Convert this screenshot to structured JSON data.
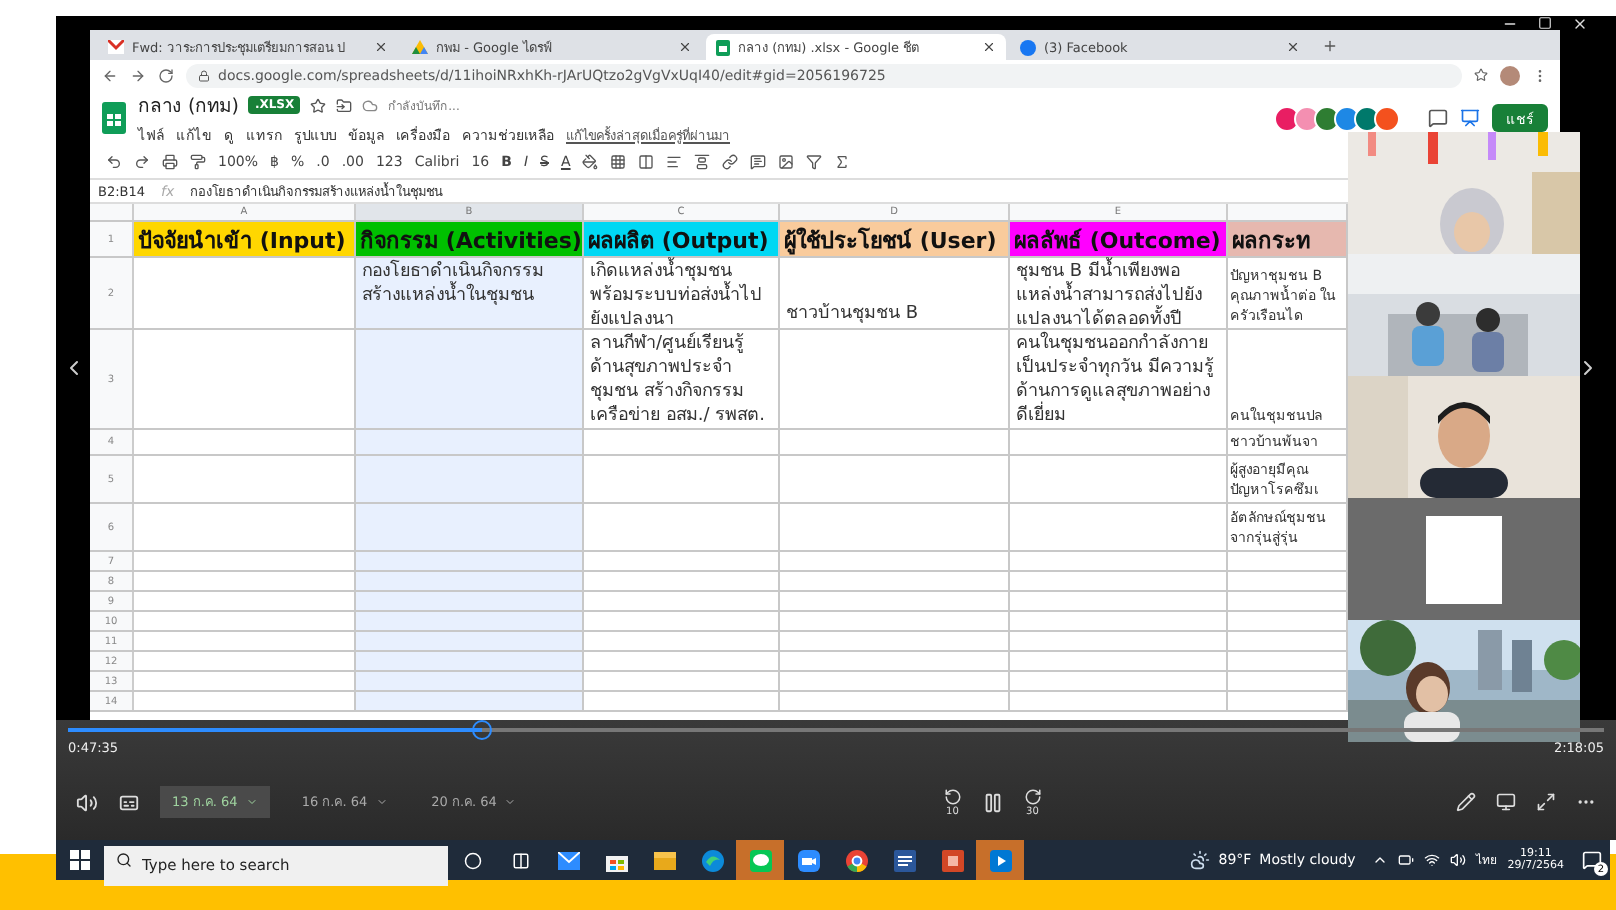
{
  "browser": {
    "tabs": [
      {
        "kind": "gmail",
        "title": "Fwd: วาระการประชุมเตรียมการสอน ป",
        "selected": false
      },
      {
        "kind": "drive",
        "title": "กพม - Google ไดรฟ์",
        "selected": false
      },
      {
        "kind": "sheets",
        "title": "กลาง (กทม) .xlsx - Google ชีต",
        "selected": true
      },
      {
        "kind": "facebook",
        "title": "(3) Facebook",
        "selected": false
      }
    ],
    "url": "docs.google.com/spreadsheets/d/11ihoiNRxhKh-rJArUQtzo2gVgVxUqI40/edit#gid=2056196725"
  },
  "sheet": {
    "title": "กลาง (กทม)",
    "badge": ".XLSX",
    "save_status": "กำลังบันทึก...",
    "menu": [
      "ไฟล์",
      "แก้ไข",
      "ดู",
      "แทรก",
      "รูปแบบ",
      "ข้อมูล",
      "เครื่องมือ",
      "ความช่วยเหลือ"
    ],
    "last_edit": "แก้ไขครั้งล่าสุดเมื่อครู่ที่ผ่านมา",
    "collaborators": [
      {
        "color": "#e91e63"
      },
      {
        "color": "#f48fb1"
      },
      {
        "color": "#2e7d32"
      },
      {
        "color": "#1e88e5"
      },
      {
        "color": "#00796b"
      },
      {
        "color": "#f4511e"
      }
    ],
    "share_label": "แชร์",
    "toolbar": [
      "100%",
      "฿",
      "%",
      ".0",
      ".00",
      "123",
      "Calibri",
      "16"
    ],
    "format": [
      "B",
      "I",
      "S",
      "A"
    ],
    "name_box": "B2:B14",
    "fx": "fx",
    "formula": "กองโยธาดำเนินกิจกรรมสร้างแหล่งน้ำในชุมชน",
    "columns": [
      {
        "letter": "A",
        "heading": "ปัจจัยนำเข้า (Input)",
        "color": "#ffd700",
        "selected": false
      },
      {
        "letter": "B",
        "heading": "กิจกรรม (Activities)",
        "color": "#00c000",
        "selected": true
      },
      {
        "letter": "C",
        "heading": "ผลผลิต (Output)",
        "color": "#00d8f4",
        "selected": false
      },
      {
        "letter": "D",
        "heading": "ผู้ใช้ประโยชน์ (User)",
        "color": "#f9cb9c",
        "selected": false
      },
      {
        "letter": "E",
        "heading": "ผลลัพธ์ (Outcome)",
        "color": "#ff00ff",
        "selected": false
      },
      {
        "heading": "ผลกระท",
        "color": "#e6b8af",
        "selected": false
      }
    ],
    "rows": [
      {
        "number": "1"
      },
      {
        "number": "2",
        "cells": {
          "B": "กองโยธาดำเนินกิจกรรม สร้างแหล่งน้ำในชุมชน",
          "C": "เกิดแหล่งน้ำชุมชน พร้อมระบบท่อส่งน้ำไปยังแปลงนา",
          "D": "ชาวบ้านชุมชน B",
          "E": "ชุมชน B มีน้ำเพียงพอ แหล่งน้ำสามารถส่งไปยังแปลงนาได้ตลอดทั้งปี",
          "F": "ปัญหาชุมชน B คุณภาพน้ำต่อ ในครัวเรือนได"
        }
      },
      {
        "number": "3",
        "cells": {
          "C": "ลานกีฬา/ศูนย์เรียนรู้ด้านสุขภาพประจำชุมชน สร้างกิจกรรมเครือข่าย อสม./ รพสต.",
          "E": "คนในชุมชนออกกำลังกายเป็นประจำทุกวัน มีความรู้ด้านการดูแลสุขภาพอย่างดีเยี่ยม",
          "F": "คนในชุมชนปล"
        }
      },
      {
        "number": "4",
        "cells": {
          "F": "ชาวบ้านพ้นจา"
        }
      },
      {
        "number": "5",
        "cells": {
          "F": "ผู้สูงอายุมีคุณ ปัญหาโรคซึมเ"
        }
      },
      {
        "number": "6",
        "cells": {
          "F": "อัตลักษณ์ชุมชน จากรุ่นสู่รุ่น"
        }
      },
      {
        "number": "7"
      },
      {
        "number": "8"
      },
      {
        "number": "9"
      },
      {
        "number": "10"
      },
      {
        "number": "11"
      },
      {
        "number": "12"
      },
      {
        "number": "13"
      },
      {
        "number": "14"
      }
    ]
  },
  "participants": [
    {
      "kind": "picture"
    },
    {
      "kind": "picture"
    },
    {
      "kind": "picture"
    },
    {
      "kind": "avatar"
    },
    {
      "kind": "picture"
    }
  ],
  "player": {
    "progress": {
      "level": 0.27
    },
    "current_time": "0:47:35",
    "duration": "2:18:05",
    "dates": [
      {
        "label": "13 ก.ค. 64",
        "selected": true
      },
      {
        "label": "16 ก.ค. 64",
        "selected": false
      },
      {
        "label": "20 ก.ค. 64",
        "selected": false
      }
    ],
    "rewind": "10",
    "forward": "30"
  },
  "taskbar": {
    "search_placeholder": "Type here to search",
    "apps": [
      {
        "kind": "mail",
        "active": false
      },
      {
        "kind": "store",
        "active": false
      },
      {
        "kind": "folder",
        "active": false
      },
      {
        "kind": "edge",
        "active": false
      },
      {
        "kind": "line",
        "active": true
      },
      {
        "kind": "zoom",
        "active": false
      },
      {
        "kind": "chrome",
        "active": false
      },
      {
        "kind": "word",
        "active": false
      },
      {
        "kind": "powerpoint",
        "active": false
      },
      {
        "kind": "player",
        "active": true
      }
    ],
    "temperature": "89°F",
    "weather": "Mostly cloudy",
    "language": "ไทย",
    "time": "19:11",
    "date": "29/7/2564",
    "notifications": "2"
  }
}
